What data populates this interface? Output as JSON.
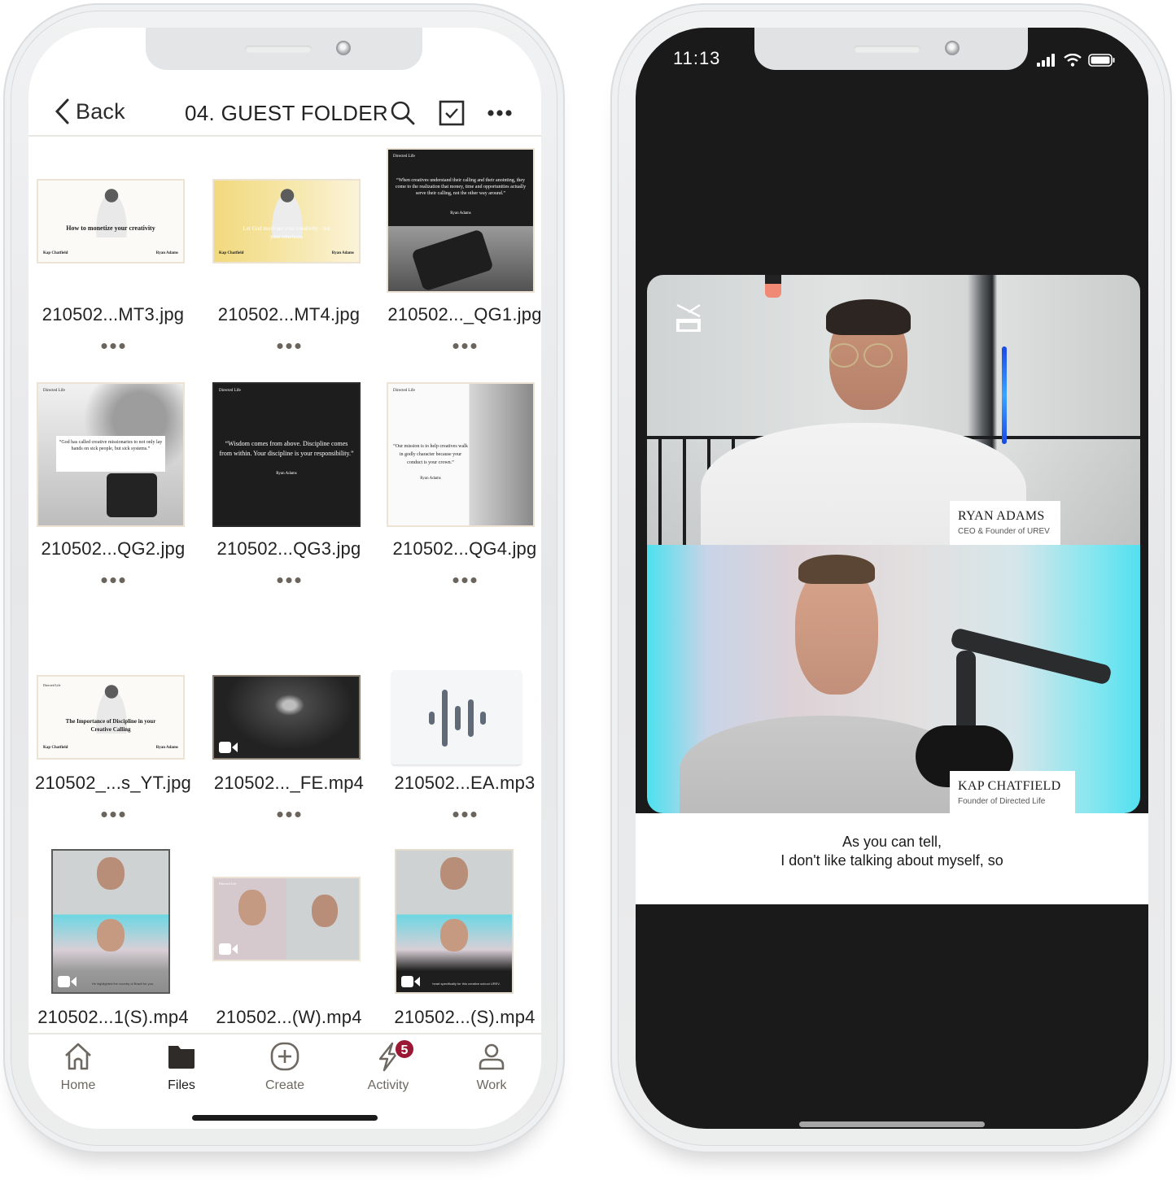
{
  "left_phone": {
    "header": {
      "back_label": "Back",
      "folder_title": "04. GUEST FOLDER",
      "icons": [
        "chevron-left-icon",
        "search-icon",
        "select-checkbox-icon",
        "more-horizontal-icon"
      ]
    },
    "files": [
      {
        "name": "210502...MT3.jpg",
        "type": "image",
        "thumb_text": "How to monetize your creativity",
        "thumb_host": "Kap Chatfield",
        "thumb_guest": "Ryan Adams"
      },
      {
        "name": "210502...MT4.jpg",
        "type": "image",
        "thumb_text": "Let God motivate your creativity - not your emotions",
        "thumb_host": "Kap Chatfield",
        "thumb_guest": "Ryan Adams"
      },
      {
        "name": "210502..._QG1.jpg",
        "type": "image",
        "thumb_text": "“When creatives understand their calling and their anointing, they come to the realization that money, time and opportunities actually serve their calling, not the other way around.”",
        "thumb_author": "Ryan Adams"
      },
      {
        "name": "210502...QG2.jpg",
        "type": "image",
        "thumb_text": "“God has called creative missionaries to not only lay hands on sick people, but sick systems.”",
        "thumb_author": "Ryan Adams"
      },
      {
        "name": "210502...QG3.jpg",
        "type": "image",
        "thumb_text": "“Wisdom comes from above. Discipline comes from within. Your discipline is your responsibility.”",
        "thumb_author": "Ryan Adams"
      },
      {
        "name": "210502...QG4.jpg",
        "type": "image",
        "thumb_text": "“Our mission is to help creatives walk in godly character because your conduct is your crown.”",
        "thumb_author": "Ryan Adams"
      },
      {
        "name": "210502_...s_YT.jpg",
        "type": "image",
        "thumb_text": "The Importance of Discipline in your Creative Calling",
        "thumb_host": "Kap Chatfield",
        "thumb_guest": "Ryan Adams"
      },
      {
        "name": "210502..._FE.mp4",
        "type": "video"
      },
      {
        "name": "210502...EA.mp3",
        "type": "audio"
      },
      {
        "name": "210502...1(S).mp4",
        "type": "video",
        "thumb_caption": "He highlighted the country of Brazil for you."
      },
      {
        "name": "210502...(W).mp4",
        "type": "video"
      },
      {
        "name": "210502...(S).mp4",
        "type": "video",
        "thumb_caption": "heart specifically for this creative school UREV."
      }
    ],
    "brand_label": "Directed Life",
    "tabbar": {
      "items": [
        {
          "label": "Home",
          "icon": "home-icon",
          "active": false
        },
        {
          "label": "Files",
          "icon": "folder-icon",
          "active": true
        },
        {
          "label": "Create",
          "icon": "plus-circle-icon",
          "active": false
        },
        {
          "label": "Activity",
          "icon": "lightning-icon",
          "active": false,
          "badge": "5"
        },
        {
          "label": "Work",
          "icon": "person-icon",
          "active": false
        }
      ]
    },
    "colors": {
      "badge": "#9b1834",
      "text": "#232323",
      "muted": "#6e6862"
    }
  },
  "right_phone": {
    "status_bar": {
      "time": "11:13",
      "icons": [
        "signal-icon",
        "wifi-icon",
        "battery-icon"
      ]
    },
    "speakers": [
      {
        "name": "RYAN ADAMS",
        "role": "CEO & Founder of UREV"
      },
      {
        "name": "KAP CHATFIELD",
        "role": "Founder of Directed Life"
      }
    ],
    "caption": {
      "line1": "As you can tell,",
      "line2": "I don't like talking about myself, so"
    }
  }
}
